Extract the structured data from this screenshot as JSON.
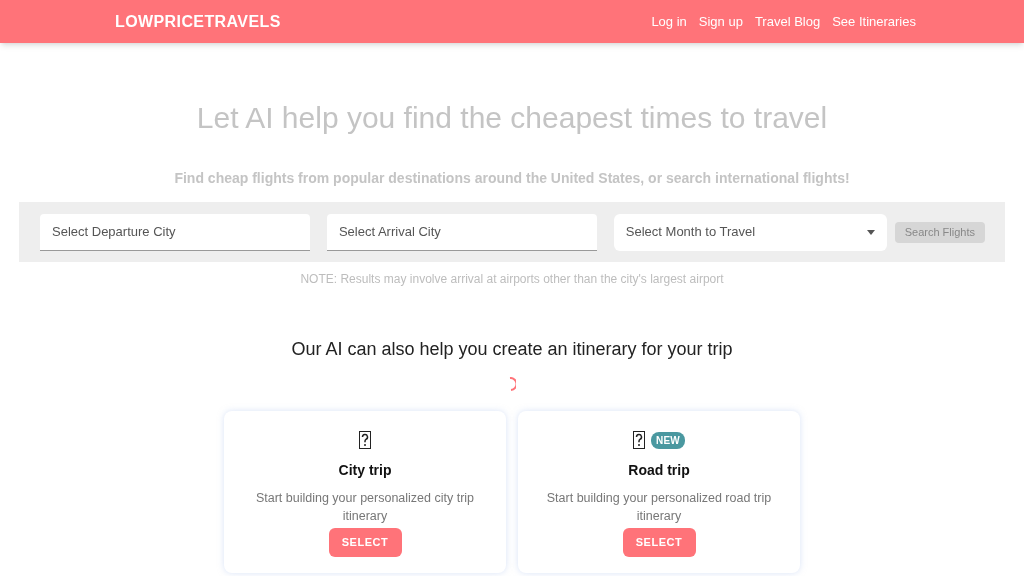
{
  "navbar": {
    "brand": "LOWPRICETRAVELS",
    "links": [
      "Log in",
      "Sign up",
      "Travel Blog",
      "See Itineraries"
    ]
  },
  "hero": {
    "title": "Let AI help you find the cheapest times to travel",
    "subtitle": "Find cheap flights from popular destinations around the United States, or search international flights!"
  },
  "search": {
    "departure": {
      "placeholder": "Select Departure City"
    },
    "arrival": {
      "placeholder": "Select Arrival City"
    },
    "month": {
      "placeholder": "Select Month to Travel"
    },
    "button": "Search Flights",
    "note": "NOTE: Results may involve arrival at airports other than the city's largest airport"
  },
  "itinerary": {
    "heading": "Our AI can also help you create an itinerary for your trip",
    "loading": true,
    "cards": [
      {
        "title": "City trip",
        "description": "Start building your personalized city trip itinerary",
        "button": "SELECT"
      },
      {
        "title": "Road trip",
        "description": "Start building your personalized road trip itinerary",
        "badge": "NEW",
        "button": "SELECT"
      }
    ]
  }
}
